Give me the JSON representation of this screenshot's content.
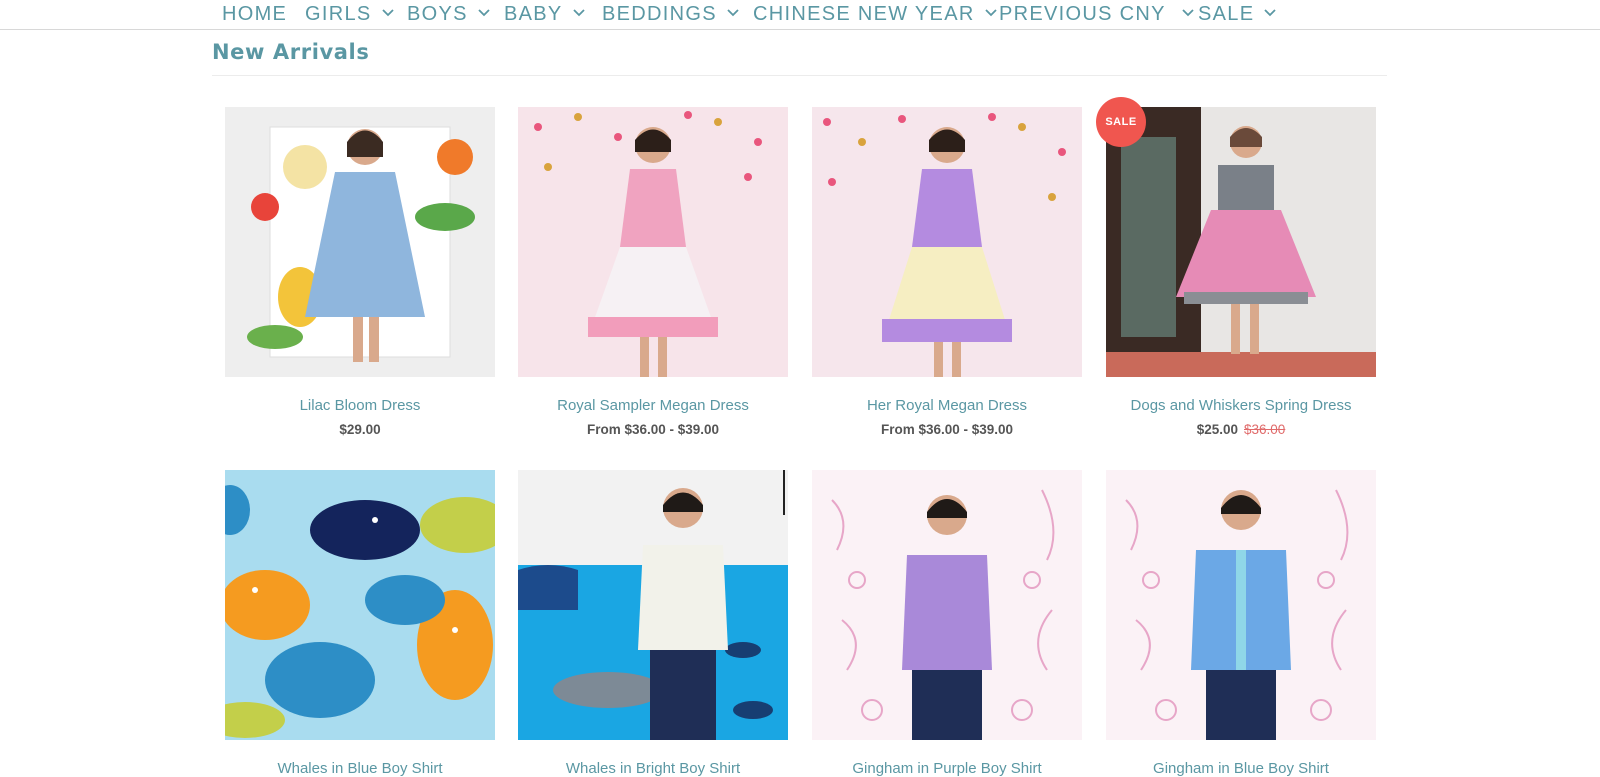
{
  "nav": {
    "items": [
      {
        "label": "HOME",
        "has_menu": false
      },
      {
        "label": "GIRLS",
        "has_menu": true
      },
      {
        "label": "BOYS",
        "has_menu": true
      },
      {
        "label": "BABY",
        "has_menu": true
      },
      {
        "label": "BEDDINGS",
        "has_menu": true
      },
      {
        "label": "CHINESE NEW YEAR",
        "has_menu": true
      },
      {
        "label": "PREVIOUS CNY",
        "has_menu": true
      },
      {
        "label": "SALE",
        "has_menu": true
      }
    ],
    "chevron_icon": "chevron-down-icon"
  },
  "section": {
    "title": "New Arrivals"
  },
  "products": [
    {
      "name": "Lilac Bloom Dress",
      "price": "$29.00",
      "compare_price": ""
    },
    {
      "name": "Royal Sampler Megan Dress",
      "price": "From $36.00 - $39.00",
      "compare_price": ""
    },
    {
      "name": "Her Royal Megan Dress",
      "price": "From $36.00 - $39.00",
      "compare_price": ""
    },
    {
      "name": "Dogs and Whiskers Spring Dress",
      "price": "$25.00",
      "compare_price": "$36.00",
      "badge": "SALE"
    },
    {
      "name": "Whales in Blue Boy Shirt",
      "price": "",
      "compare_price": ""
    },
    {
      "name": "Whales in Bright Boy Shirt",
      "price": "",
      "compare_price": ""
    },
    {
      "name": "Gingham in Purple Boy Shirt",
      "price": "",
      "compare_price": ""
    },
    {
      "name": "Gingham in Blue Boy Shirt",
      "price": "",
      "compare_price": ""
    }
  ],
  "colors": {
    "accent": "#5a97a3",
    "sale_badge": "#f0564f",
    "compare_price": "#e06a6a"
  }
}
